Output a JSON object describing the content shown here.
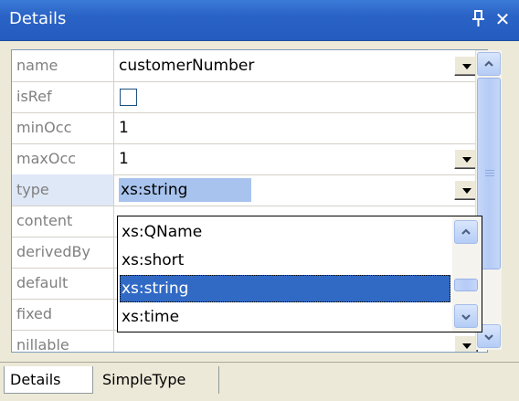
{
  "window": {
    "title": "Details"
  },
  "titlebar": {
    "pin_icon": "pin-icon",
    "close_icon": "close-icon",
    "close_glyph": "✕",
    "pin_glyph": "ᵖ"
  },
  "properties": [
    {
      "name": "name",
      "value": "customerNumber"
    },
    {
      "name": "isRef",
      "value": ""
    },
    {
      "name": "minOcc",
      "value": "1"
    },
    {
      "name": "maxOcc",
      "value": "1"
    },
    {
      "name": "type",
      "value": "xs:string"
    },
    {
      "name": "content",
      "value": ""
    },
    {
      "name": "derivedBy",
      "value": ""
    },
    {
      "name": "default",
      "value": ""
    },
    {
      "name": "fixed",
      "value": ""
    },
    {
      "name": "nillable",
      "value": ""
    }
  ],
  "type_dropdown": {
    "options": [
      "xs:QName",
      "xs:short",
      "xs:string",
      "xs:time"
    ],
    "selected": "xs:string"
  },
  "tabs": [
    {
      "label": "Details",
      "active": true
    },
    {
      "label": "SimpleType",
      "active": false
    }
  ],
  "colors": {
    "titlebar": "#245bc0",
    "selection": "#316ac5",
    "row_highlight": "#a8c4ee"
  }
}
